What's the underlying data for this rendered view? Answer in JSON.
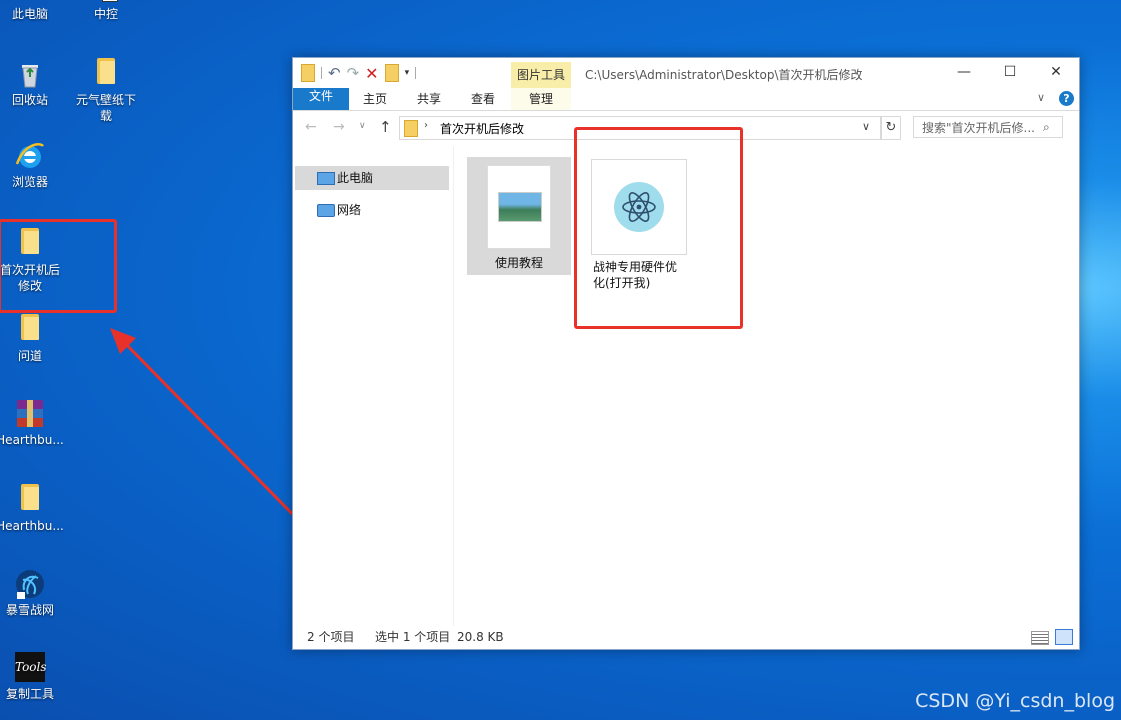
{
  "desktop": {
    "icons": [
      {
        "label": "此电脑"
      },
      {
        "label": "中控"
      },
      {
        "label": "回收站"
      },
      {
        "label": "元气壁纸下载"
      },
      {
        "label": "浏览器"
      },
      {
        "label": "首次开机后修改"
      },
      {
        "label": "问道"
      },
      {
        "label": "Hearthbu..."
      },
      {
        "label": "Hearthbu..."
      },
      {
        "label": "暴雪战网"
      },
      {
        "label": "复制工具"
      }
    ],
    "tools_icon_text": "Tools"
  },
  "window": {
    "title_path": "C:\\Users\\Administrator\\Desktop\\首次开机后修改",
    "context_tab": "图片工具",
    "ribbon_tabs": [
      "文件",
      "主页",
      "共享",
      "查看",
      "管理"
    ],
    "address": "首次开机后修改",
    "search_placeholder": "搜索\"首次开机后修...",
    "nav": [
      "此电脑",
      "网络"
    ],
    "files": [
      {
        "name": "使用教程"
      },
      {
        "name": "战神专用硬件优化(打开我)"
      }
    ],
    "status": {
      "count": "2 个项目",
      "selected": "选中 1 个项目",
      "size": "20.8 KB"
    }
  },
  "watermark": "CSDN @Yi_csdn_blog",
  "colors": {
    "accent": "#1979ca",
    "highlight": "#e8312a",
    "context_tab": "#f8eeaa"
  }
}
